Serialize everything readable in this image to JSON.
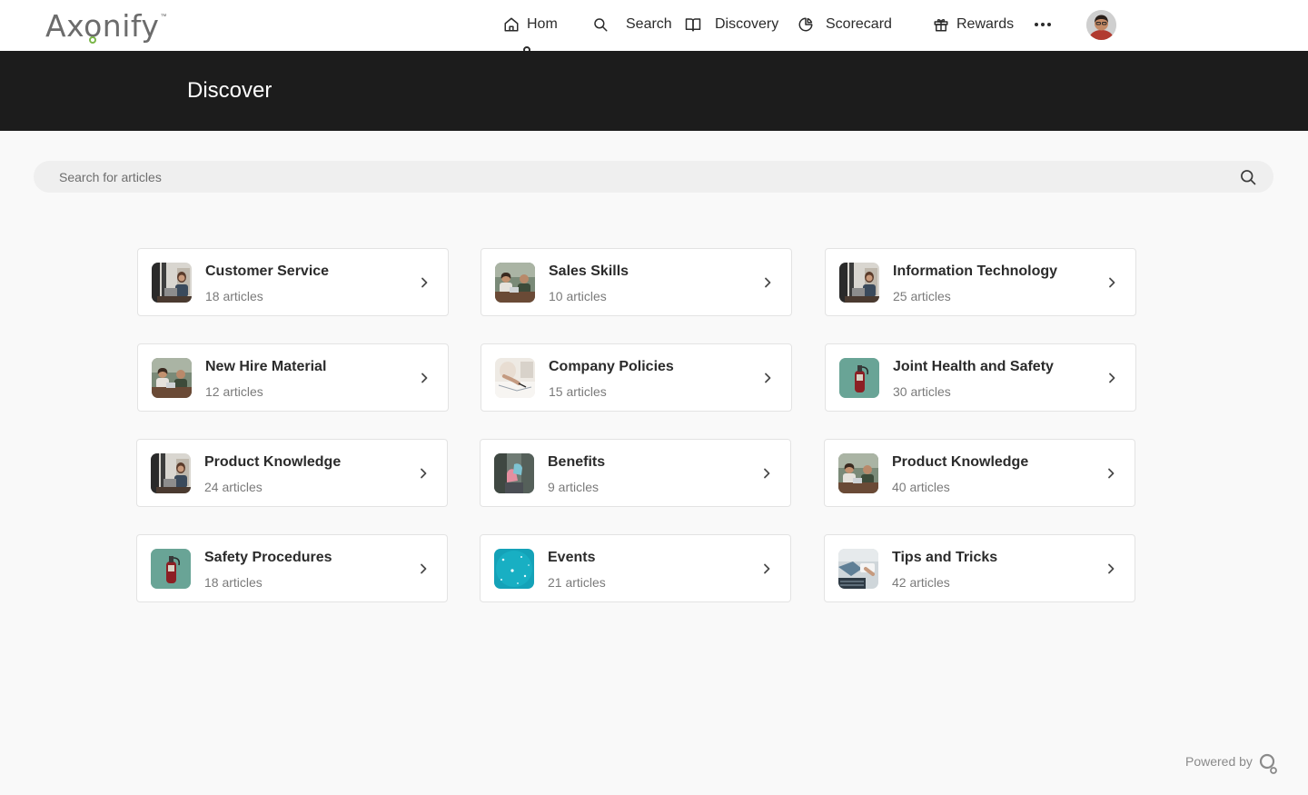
{
  "brand": {
    "name": "Axonify",
    "tm": "™"
  },
  "nav": {
    "home": "Hom",
    "search": "Search",
    "discovery": "Discovery",
    "scorecard": "Scorecard",
    "rewards": "Rewards",
    "more_icon": "more-horizontal-icon",
    "avatar_icon": "user-avatar"
  },
  "page": {
    "title": "Discover"
  },
  "search": {
    "placeholder": "Search for articles",
    "value": "",
    "icon": "search-icon"
  },
  "categories": [
    {
      "title": "Customer Service",
      "count": "18 articles",
      "thumb": "office-photo"
    },
    {
      "title": "Sales Skills",
      "count": "10 articles",
      "thumb": "meeting-photo"
    },
    {
      "title": "Information Technology",
      "count": "25 articles",
      "thumb": "office-photo"
    },
    {
      "title": "New Hire Material",
      "count": "12 articles",
      "thumb": "meeting-photo"
    },
    {
      "title": "Company Policies",
      "count": "15 articles",
      "thumb": "writing-photo"
    },
    {
      "title": "Joint Health and Safety",
      "count": "30 articles",
      "thumb": "extinguisher-photo"
    },
    {
      "title": "Product Knowledge",
      "count": "24 articles",
      "thumb": "office-photo"
    },
    {
      "title": "Benefits",
      "count": "9 articles",
      "thumb": "shoes-photo"
    },
    {
      "title": "Product Knowledge",
      "count": "40 articles",
      "thumb": "meeting-photo"
    },
    {
      "title": "Safety Procedures",
      "count": "18 articles",
      "thumb": "extinguisher-photo"
    },
    {
      "title": "Events",
      "count": "21 articles",
      "thumb": "sparkle-photo"
    },
    {
      "title": "Tips and Tricks",
      "count": "42 articles",
      "thumb": "desk-photo"
    }
  ],
  "footer": {
    "powered_by": "Powered by"
  },
  "colors": {
    "brand_green": "#7ab648",
    "banner": "#1c1c1c",
    "background": "#f9f9f9"
  }
}
